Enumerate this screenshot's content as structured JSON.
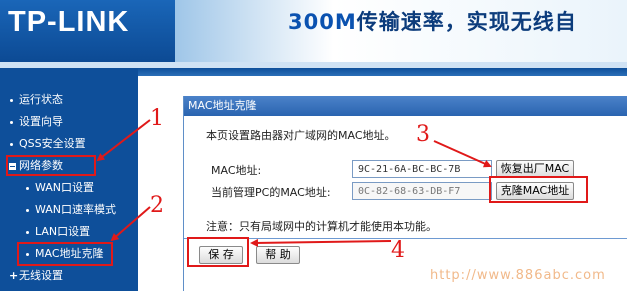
{
  "header": {
    "logo": "TP-LINK",
    "banner_prefix": "300M",
    "banner_text": "传输速率，实现无线自"
  },
  "sidebar": {
    "items": [
      {
        "label": "运行状态"
      },
      {
        "label": "设置向导"
      },
      {
        "label": "QSS安全设置"
      },
      {
        "label": "网络参数"
      },
      {
        "label": "WAN口设置"
      },
      {
        "label": "WAN口速率模式"
      },
      {
        "label": "LAN口设置"
      },
      {
        "label": "MAC地址克隆"
      },
      {
        "label": "无线设置"
      }
    ]
  },
  "panel": {
    "title": "MAC地址克隆",
    "description": "本页设置路由器对广域网的MAC地址。",
    "mac_label": "MAC地址:",
    "mac_value": "9C-21-6A-BC-BC-7B",
    "restore_button": "恢复出厂MAC",
    "pc_mac_label": "当前管理PC的MAC地址:",
    "pc_mac_value": "0C-82-68-63-DB-F7",
    "clone_button": "克隆MAC地址",
    "note": "注意：只有局域网中的计算机才能使用本功能。",
    "save_button": "保 存",
    "help_button": "帮 助"
  },
  "annotations": {
    "n1": "1",
    "n2": "2",
    "n3": "3",
    "n4": "4",
    "color": "#e01919"
  },
  "watermark": "http://www.886abc.com"
}
